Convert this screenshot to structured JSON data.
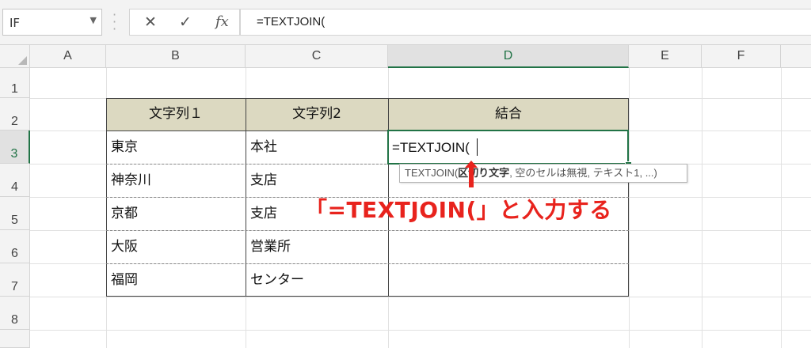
{
  "formula_bar": {
    "name_box": "IF",
    "cancel_icon": "✕",
    "enter_icon": "✓",
    "fx_label": "fx",
    "formula": "=TEXTJOIN("
  },
  "columns": [
    "A",
    "B",
    "C",
    "D",
    "E",
    "F"
  ],
  "selected_column": "D",
  "rows": [
    "1",
    "2",
    "3",
    "4",
    "5",
    "6",
    "7",
    "8"
  ],
  "selected_row": "3",
  "table": {
    "headers": [
      "文字列１",
      "文字列2",
      "結合"
    ],
    "rows": [
      [
        "東京",
        "本社",
        ""
      ],
      [
        "神奈川",
        "支店",
        ""
      ],
      [
        "京都",
        "支店",
        ""
      ],
      [
        "大阪",
        "営業所",
        ""
      ],
      [
        "福岡",
        "センター",
        ""
      ]
    ]
  },
  "active_cell": {
    "ref": "D3",
    "value": "=TEXTJOIN("
  },
  "tooltip": {
    "func": "TEXTJOIN(",
    "bold_arg": "区切り文字",
    "rest": ", 空のセルは無視, テキスト1, ...)"
  },
  "annotation": {
    "text": "「=TEXTJOIN(」と入力する",
    "color": "#e8231d"
  },
  "colors": {
    "accent": "#217346",
    "header_fill": "#dcd9c1"
  }
}
